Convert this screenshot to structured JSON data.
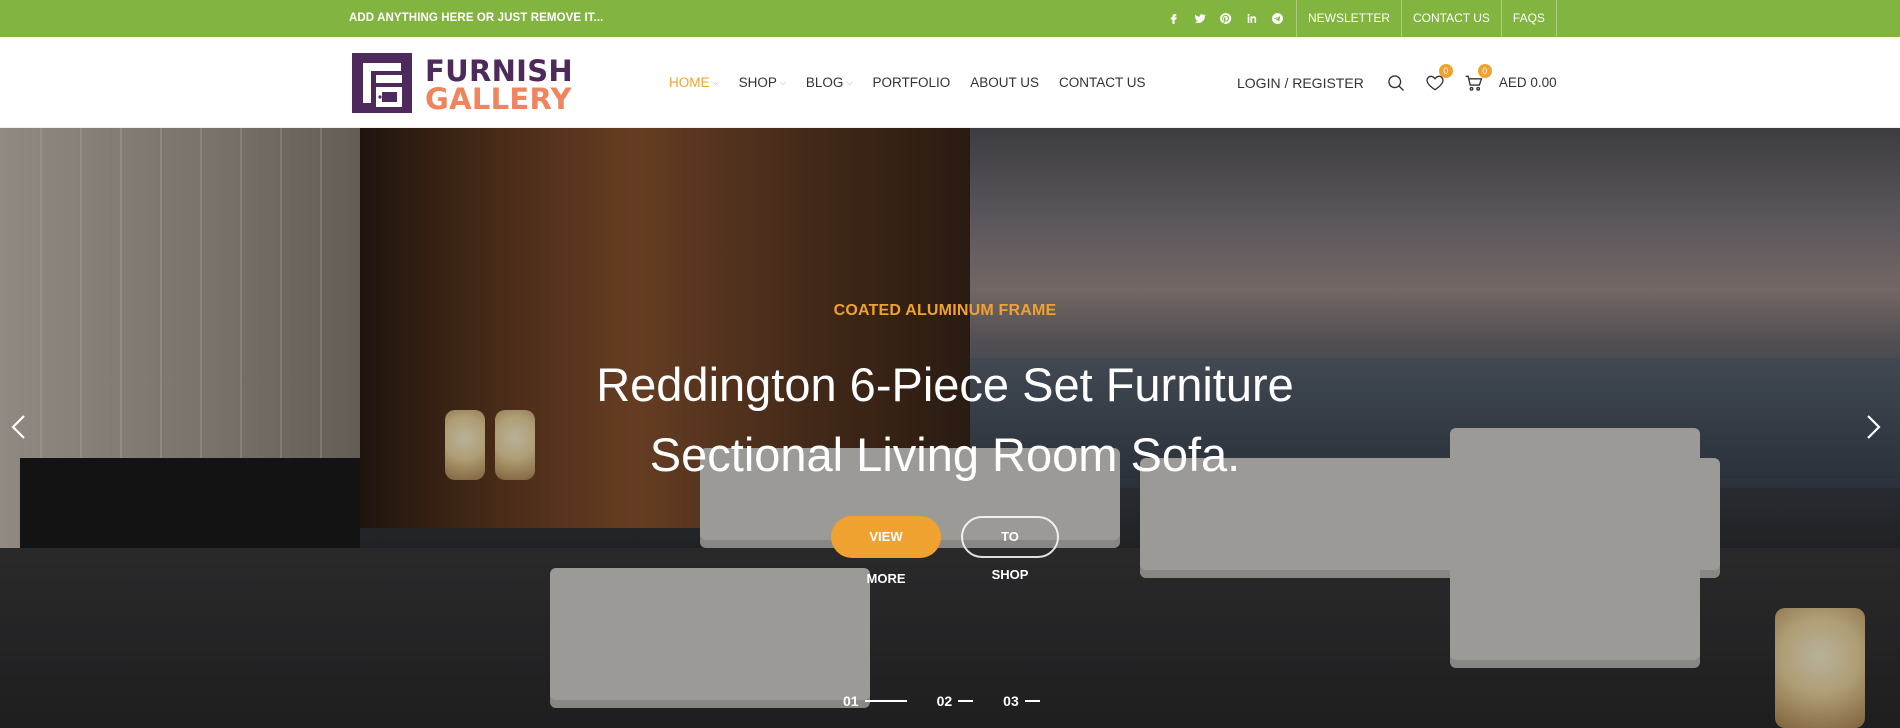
{
  "topbar": {
    "promo": "ADD ANYTHING HERE OR JUST REMOVE IT...",
    "socials": [
      "facebook-icon",
      "twitter-icon",
      "pinterest-icon",
      "linkedin-icon",
      "telegram-icon"
    ],
    "links": [
      "NEWSLETTER",
      "CONTACT US",
      "FAQS"
    ]
  },
  "header": {
    "logo_line1": "FURNISH",
    "logo_line2": "GALLERY",
    "nav": [
      {
        "label": "HOME",
        "active": true,
        "dropdown": true
      },
      {
        "label": "SHOP",
        "active": false,
        "dropdown": true
      },
      {
        "label": "BLOG",
        "active": false,
        "dropdown": true
      },
      {
        "label": "PORTFOLIO",
        "active": false,
        "dropdown": false
      },
      {
        "label": "ABOUT US",
        "active": false,
        "dropdown": false
      },
      {
        "label": "CONTACT US",
        "active": false,
        "dropdown": false
      }
    ],
    "login": "LOGIN / REGISTER",
    "wishlist_count": "0",
    "cart_count": "0",
    "cart_total": "AED 0.00"
  },
  "hero": {
    "subtitle": "COATED ALUMINUM FRAME",
    "title_line1": "Reddington 6-Piece Set Furniture",
    "title_line2": "Sectional Living Room Sofa.",
    "primary_button": "VIEW MORE",
    "secondary_button": "TO SHOP",
    "slides": [
      "01",
      "02",
      "03"
    ],
    "active_slide": "01"
  },
  "colors": {
    "topbar": "#82b440",
    "accent": "#f0a230",
    "logo_purple": "#4e2a5c",
    "logo_orange": "#f0845c"
  }
}
